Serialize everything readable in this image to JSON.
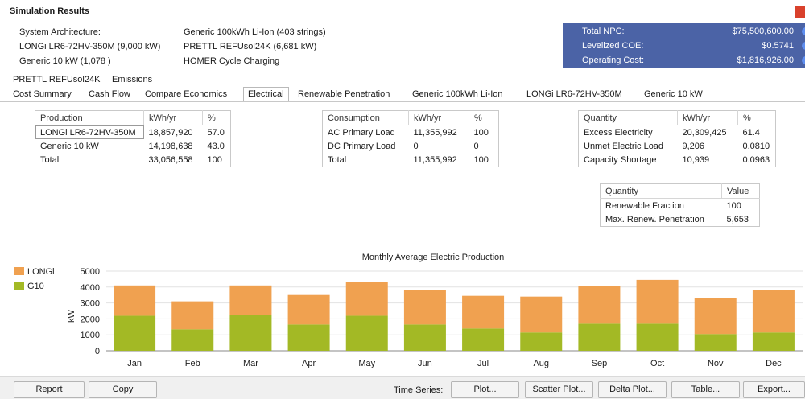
{
  "window": {
    "title": "Simulation Results"
  },
  "architecture": {
    "label": "System Architecture:",
    "pv": "LONGi LR6-72HV-350M (9,000 kW)",
    "generator": "Generic 10 kW (1,078 )",
    "battery": "Generic 100kWh Li-Ion (403 strings)",
    "converter": "PRETTL REFUsol24K (6,681 kW)",
    "dispatch": "HOMER Cycle Charging"
  },
  "summary": {
    "rows": [
      {
        "label": "Total NPC:",
        "value": "$75,500,600.00"
      },
      {
        "label": "Levelized COE:",
        "value": "$0.5741"
      },
      {
        "label": "Operating Cost:",
        "value": "$1,816,926.00"
      }
    ]
  },
  "tabs_top": [
    "PRETTL REFUsol24K",
    "Emissions"
  ],
  "tabs_bottom": [
    "Cost Summary",
    "Cash Flow",
    "Compare Economics",
    "Electrical",
    "Renewable Penetration",
    "Generic 100kWh Li-Ion",
    "LONGi LR6-72HV-350M",
    "Generic 10 kW"
  ],
  "active_tab": "Electrical",
  "production_table": {
    "headers": [
      "Production",
      "kWh/yr",
      "%"
    ],
    "rows": [
      [
        "LONGi LR6-72HV-350M",
        "18,857,920",
        "57.0"
      ],
      [
        "Generic 10 kW",
        "14,198,638",
        "43.0"
      ],
      [
        "Total",
        "33,056,558",
        "100"
      ]
    ]
  },
  "consumption_table": {
    "headers": [
      "Consumption",
      "kWh/yr",
      "%"
    ],
    "rows": [
      [
        "AC Primary Load",
        "11,355,992",
        "100"
      ],
      [
        "DC Primary Load",
        "0",
        "0"
      ],
      [
        "Total",
        "11,355,992",
        "100"
      ]
    ]
  },
  "quantity_table": {
    "headers": [
      "Quantity",
      "kWh/yr",
      "%"
    ],
    "rows": [
      [
        "Excess Electricity",
        "20,309,425",
        "61.4"
      ],
      [
        "Unmet Electric Load",
        "9,206",
        "0.0810"
      ],
      [
        "Capacity Shortage",
        "10,939",
        "0.0963"
      ]
    ]
  },
  "renewable_table": {
    "headers": [
      "Quantity",
      "Value"
    ],
    "rows": [
      [
        "Renewable Fraction",
        "100"
      ],
      [
        "Max. Renew. Penetration",
        "5,653"
      ]
    ]
  },
  "chart_data": {
    "type": "bar",
    "stacked": true,
    "title": "Monthly Average Electric Production",
    "ylabel": "kW",
    "xlabel": "",
    "ylim": [
      0,
      5000
    ],
    "yticks": [
      0,
      1000,
      2000,
      3000,
      4000,
      5000
    ],
    "categories": [
      "Jan",
      "Feb",
      "Mar",
      "Apr",
      "May",
      "Jun",
      "Jul",
      "Aug",
      "Sep",
      "Oct",
      "Nov",
      "Dec"
    ],
    "series": [
      {
        "name": "G10",
        "color": "#a3b925",
        "values": [
          2200,
          1350,
          2250,
          1650,
          2200,
          1650,
          1400,
          1150,
          1700,
          1700,
          1050,
          1150
        ]
      },
      {
        "name": "LONGi",
        "color": "#f0a150",
        "values": [
          1900,
          1750,
          1850,
          1850,
          2100,
          2150,
          2050,
          2250,
          2350,
          2750,
          2250,
          2650
        ]
      }
    ],
    "legend": "top-left"
  },
  "buttons": {
    "report": "Report",
    "copy": "Copy",
    "time_series_label": "Time Series:",
    "plot": "Plot...",
    "scatter_plot": "Scatter Plot...",
    "delta_plot": "Delta Plot...",
    "table": "Table...",
    "export": "Export..."
  }
}
